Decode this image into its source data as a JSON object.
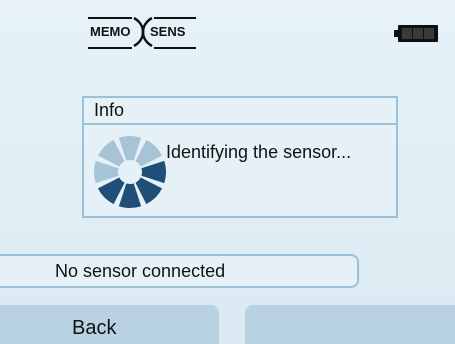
{
  "header": {
    "logo_left": "MEMO",
    "logo_right": "SENS",
    "battery_icon": "battery-full-icon"
  },
  "dialog": {
    "title": "Info",
    "message": "Identifying the sensor...",
    "spinner_icon": "loading-spinner-icon"
  },
  "status": {
    "text": "No sensor connected"
  },
  "softkeys": {
    "left_label": "Back",
    "right_label": ""
  },
  "colors": {
    "background": "#e3f0f6",
    "border": "#9ec0d6",
    "softkey": "#b9d2e2",
    "spinner_dark": "#1f4f78",
    "spinner_light": "#a7c3d6"
  }
}
